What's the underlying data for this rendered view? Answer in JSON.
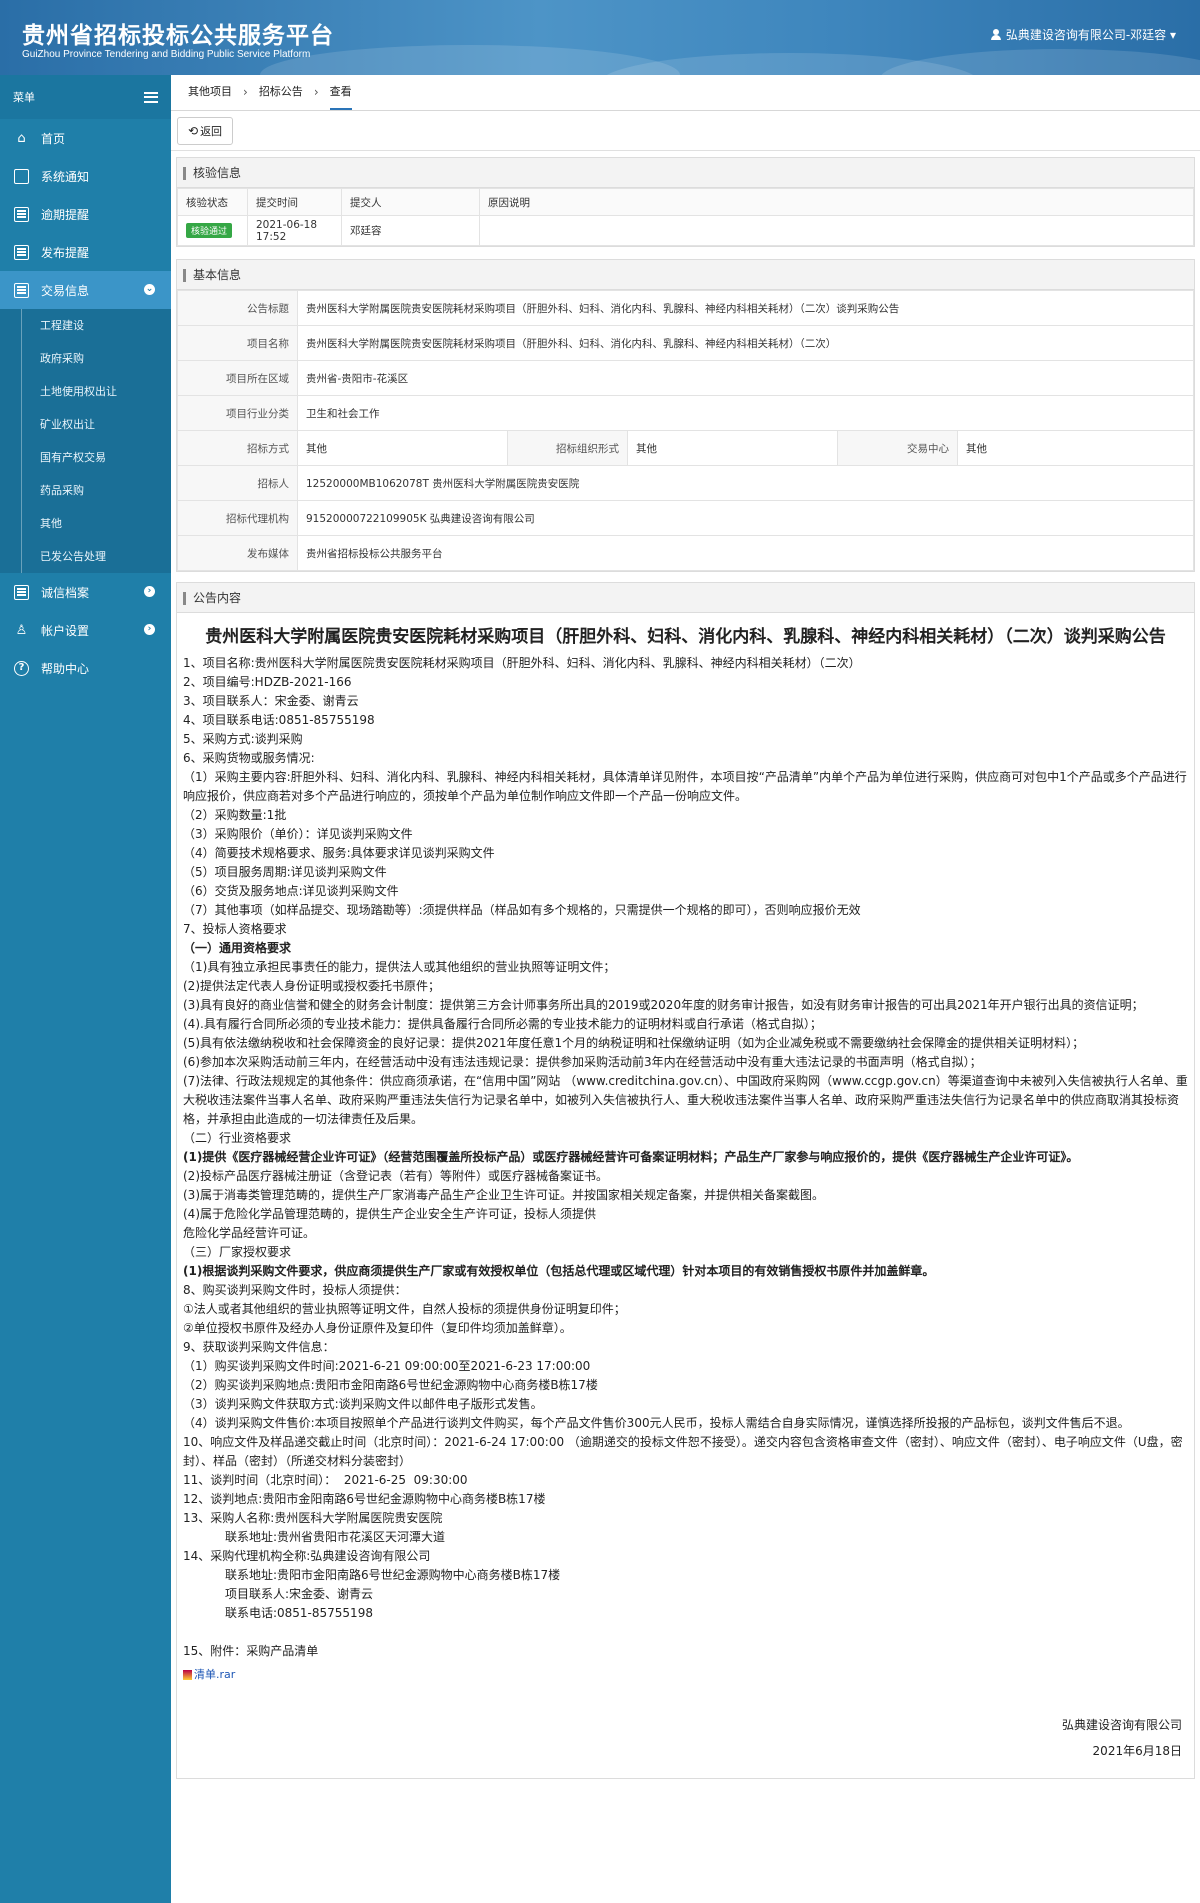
{
  "header": {
    "title_cn": "贵州省招标投标公共服务平台",
    "title_en": "GuiZhou Province Tendering and Bidding Public Service Platform",
    "user": "弘典建设咨询有限公司-邓廷容"
  },
  "sidebar": {
    "menu_label": "菜单",
    "items": [
      {
        "label": "首页",
        "icon": "home-icon"
      },
      {
        "label": "系统通知",
        "icon": "monitor-icon"
      },
      {
        "label": "逾期提醒",
        "icon": "calendar-icon"
      },
      {
        "label": "发布提醒",
        "icon": "calendar-icon"
      },
      {
        "label": "交易信息",
        "icon": "calendar-icon"
      }
    ],
    "sub_items": [
      "工程建设",
      "政府采购",
      "土地使用权出让",
      "矿业权出让",
      "国有产权交易",
      "药品采购",
      "其他",
      "已发公告处理"
    ],
    "items_bottom": [
      {
        "label": "诚信档案",
        "icon": "list-icon"
      },
      {
        "label": "帐户设置",
        "icon": "user-icon"
      },
      {
        "label": "帮助中心",
        "icon": "help-icon"
      }
    ]
  },
  "breadcrumb": [
    "其他项目",
    "招标公告",
    "查看"
  ],
  "back_label": "返回",
  "verify": {
    "title": "核验信息",
    "headers": [
      "核验状态",
      "提交时间",
      "提交人",
      "原因说明"
    ],
    "row": {
      "status": "核验通过",
      "time": "2021-06-18 17:52",
      "submitter": "邓廷容",
      "reason": ""
    }
  },
  "basic": {
    "title": "基本信息",
    "rows": [
      {
        "label": "公告标题",
        "value": "贵州医科大学附属医院贵安医院耗材采购项目（肝胆外科、妇科、消化内科、乳腺科、神经内科相关耗材）（二次）谈判采购公告"
      },
      {
        "label": "项目名称",
        "value": "贵州医科大学附属医院贵安医院耗材采购项目（肝胆外科、妇科、消化内科、乳腺科、神经内科相关耗材）（二次）"
      },
      {
        "label": "项目所在区域",
        "value": "贵州省-贵阳市-花溪区"
      },
      {
        "label": "项目行业分类",
        "value": "卫生和社会工作"
      }
    ],
    "method_label": "招标方式",
    "method": "其他",
    "org_label": "招标组织形式",
    "org": "其他",
    "center_label": "交易中心",
    "center": "其他",
    "rows2": [
      {
        "label": "招标人",
        "value": "12520000MB1062078T 贵州医科大学附属医院贵安医院"
      },
      {
        "label": "招标代理机构",
        "value": "91520000722109905K 弘典建设咨询有限公司"
      },
      {
        "label": "发布媒体",
        "value": "贵州省招标投标公共服务平台"
      }
    ]
  },
  "notice": {
    "title": "公告内容",
    "doc_title": "贵州医科大学附属医院贵安医院耗材采购项目（肝胆外科、妇科、消化内科、乳腺科、神经内科相关耗材）（二次）谈判采购公告",
    "lines": [
      "1、项目名称:贵州医科大学附属医院贵安医院耗材采购项目（肝胆外科、妇科、消化内科、乳腺科、神经内科相关耗材）（二次）",
      "2、项目编号:HDZB-2021-166",
      "3、项目联系人：宋金委、谢青云",
      "4、项目联系电话:0851-85755198",
      "5、采购方式:谈判采购",
      "6、采购货物或服务情况:",
      "（1）采购主要内容:肝胆外科、妇科、消化内科、乳腺科、神经内科相关耗材，具体清单详见附件，本项目按“产品清单”内单个产品为单位进行采购，供应商可对包中1个产品或多个产品进行响应报价，供应商若对多个产品进行响应的，须按单个产品为单位制作响应文件即一个产品一份响应文件。",
      "（2）采购数量:1批",
      "（3）采购限价（单价）：详见谈判采购文件",
      "（4）简要技术规格要求、服务:具体要求详见谈判采购文件",
      "（5）项目服务周期:详见谈判采购文件",
      "（6）交货及服务地点:详见谈判采购文件",
      "（7）其他事项（如样品提交、现场踏勘等）:须提供样品（样品如有多个规格的，只需提供一个规格的即可），否则响应报价无效",
      "7、投标人资格要求",
      "（一）通用资格要求",
      "（1)具有独立承担民事责任的能力，提供法人或其他组织的营业执照等证明文件；",
      "(2)提供法定代表人身份证明或授权委托书原件；",
      "(3)具有良好的商业信誉和健全的财务会计制度：提供第三方会计师事务所出具的2019或2020年度的财务审计报告，如没有财务审计报告的可出具2021年开户银行出具的资信证明；",
      "(4).具有履行合同所必须的专业技术能力：提供具备履行合同所必需的专业技术能力的证明材料或自行承诺（格式自拟）；",
      "(5)具有依法缴纳税收和社会保障资金的良好记录：提供2021年度任意1个月的纳税证明和社保缴纳证明（如为企业减免税或不需要缴纳社会保障金的提供相关证明材料）；",
      "(6)参加本次采购活动前三年内，在经营活动中没有违法违规记录：提供参加采购活动前3年内在经营活动中没有重大违法记录的书面声明（格式自拟）；",
      "(7)法律、行政法规规定的其他条件：供应商须承诺，在“信用中国”网站 （www.creditchina.gov.cn）、中国政府采购网（www.ccgp.gov.cn）等渠道查询中未被列入失信被执行人名单、重大税收违法案件当事人名单、政府采购严重违法失信行为记录名单中，如被列入失信被执行人、重大税收违法案件当事人名单、政府采购严重违法失信行为记录名单中的供应商取消其投标资格，并承担由此造成的一切法律责任及后果。",
      "（二）行业资格要求",
      "(1)提供《医疗器械经营企业许可证》（经营范围覆盖所投标产品）或医疗器械经营许可备案证明材料；产品生产厂家参与响应报价的，提供《医疗器械生产企业许可证》。",
      "(2)投标产品医疗器械注册证（含登记表（若有）等附件）或医疗器械备案证书。",
      "(3)属于消毒类管理范畴的，提供生产厂家消毒产品生产企业卫生许可证。并按国家相关规定备案，并提供相关备案截图。",
      "(4)属于危险化学品管理范畴的，提供生产企业安全生产许可证，投标人须提供",
      "危险化学品经营许可证。",
      "（三）厂家授权要求",
      "(1)根据谈判采购文件要求，供应商须提供生产厂家或有效授权单位（包括总代理或区域代理）针对本项目的有效销售授权书原件并加盖鲜章。",
      "8、购买谈判采购文件时，投标人须提供：",
      "①法人或者其他组织的营业执照等证明文件，自然人投标的须提供身份证明复印件；",
      "②单位授权书原件及经办人身份证原件及复印件（复印件均须加盖鲜章）。",
      "9、获取谈判采购文件信息：",
      "（1）购买谈判采购文件时间:2021-6-21 09:00:00至2021-6-23 17:00:00",
      "（2）购买谈判采购地点:贵阳市金阳南路6号世纪金源购物中心商务楼B栋17楼",
      "（3）谈判采购文件获取方式:谈判采购文件以邮件电子版形式发售。",
      "（4）谈判采购文件售价:本项目按照单个产品进行谈判文件购买，每个产品文件售价300元人民币，投标人需结合自身实际情况，谨慎选择所投报的产品标包，谈判文件售后不退。",
      "10、响应文件及样品递交截止时间（北京时间）：2021-6-24 17:00:00 （逾期递交的投标文件恕不接受）。递交内容包含资格审查文件（密封）、响应文件（密封）、电子响应文件（U盘，密封）、样品（密封）（所递交材料分装密封）",
      "11、谈判时间（北京时间）：  2021-6-25  09:30:00",
      "12、谈判地点:贵阳市金阳南路6号世纪金源购物中心商务楼B栋17楼",
      "13、采购人名称:贵州医科大学附属医院贵安医院",
      "           联系地址:贵州省贵阳市花溪区天河潭大道",
      "14、采购代理机构全称:弘典建设咨询有限公司",
      "           联系地址:贵阳市金阳南路6号世纪金源购物中心商务楼B栋17楼",
      "           项目联系人:宋金委、谢青云",
      "           联系电话:0851-85755198",
      "",
      "15、附件：采购产品清单"
    ],
    "bold_lines": [
      14,
      23,
      29
    ],
    "attachment": "清单.rar",
    "sign_company": "弘典建设咨询有限公司",
    "sign_date": "2021年6月18日"
  }
}
